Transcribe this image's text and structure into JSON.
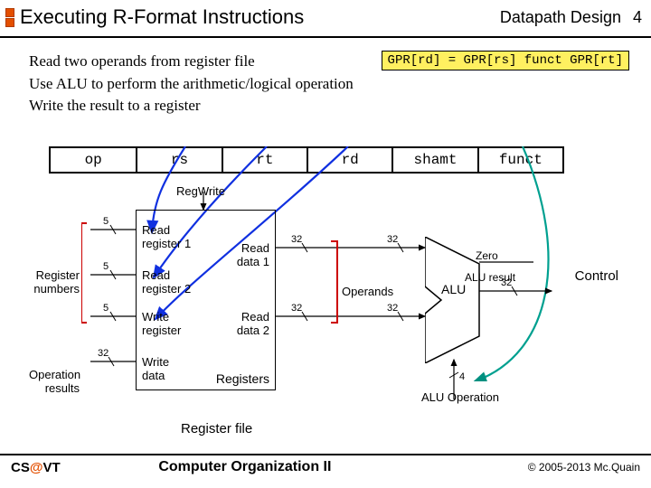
{
  "header": {
    "title": "Executing R-Format Instructions",
    "section": "Datapath Design",
    "page": "4"
  },
  "highlight": "GPR[rd] = GPR[rs] funct GPR[rt]",
  "bullets": [
    "Read two operands from register file",
    "Use ALU to perform the arithmetic/logical operation",
    "Write the result to a register"
  ],
  "instruction_fields": [
    "op",
    "rs",
    "rt",
    "rd",
    "shamt",
    "funct"
  ],
  "labels": {
    "regwrite": "RegWrite",
    "read_reg1": "Read",
    "read_reg1b": "register 1",
    "read_reg2": "Read",
    "read_reg2b": "register 2",
    "write_reg": "Write",
    "write_regb": "register",
    "write_data": "Write",
    "write_datab": "data",
    "read_data1": "Read",
    "read_data1b": "data 1",
    "read_data2": "Read",
    "read_data2b": "data 2",
    "registers": "Registers",
    "register_file": "Register file",
    "register_numbers": "Register numbers",
    "operation_results": "Operation results",
    "operands": "Operands",
    "control": "Control",
    "alu": "ALU",
    "alu_result": "ALU result",
    "alu_operation": "ALU Operation",
    "zero": "Zero"
  },
  "bus_widths": {
    "regnum": "5",
    "data": "32",
    "aluop": "4"
  },
  "footer": {
    "left_a": "CS",
    "left_b": "@",
    "left_c": "VT",
    "center": "Computer Organization II",
    "right": "© 2005-2013 Mc.Quain"
  }
}
